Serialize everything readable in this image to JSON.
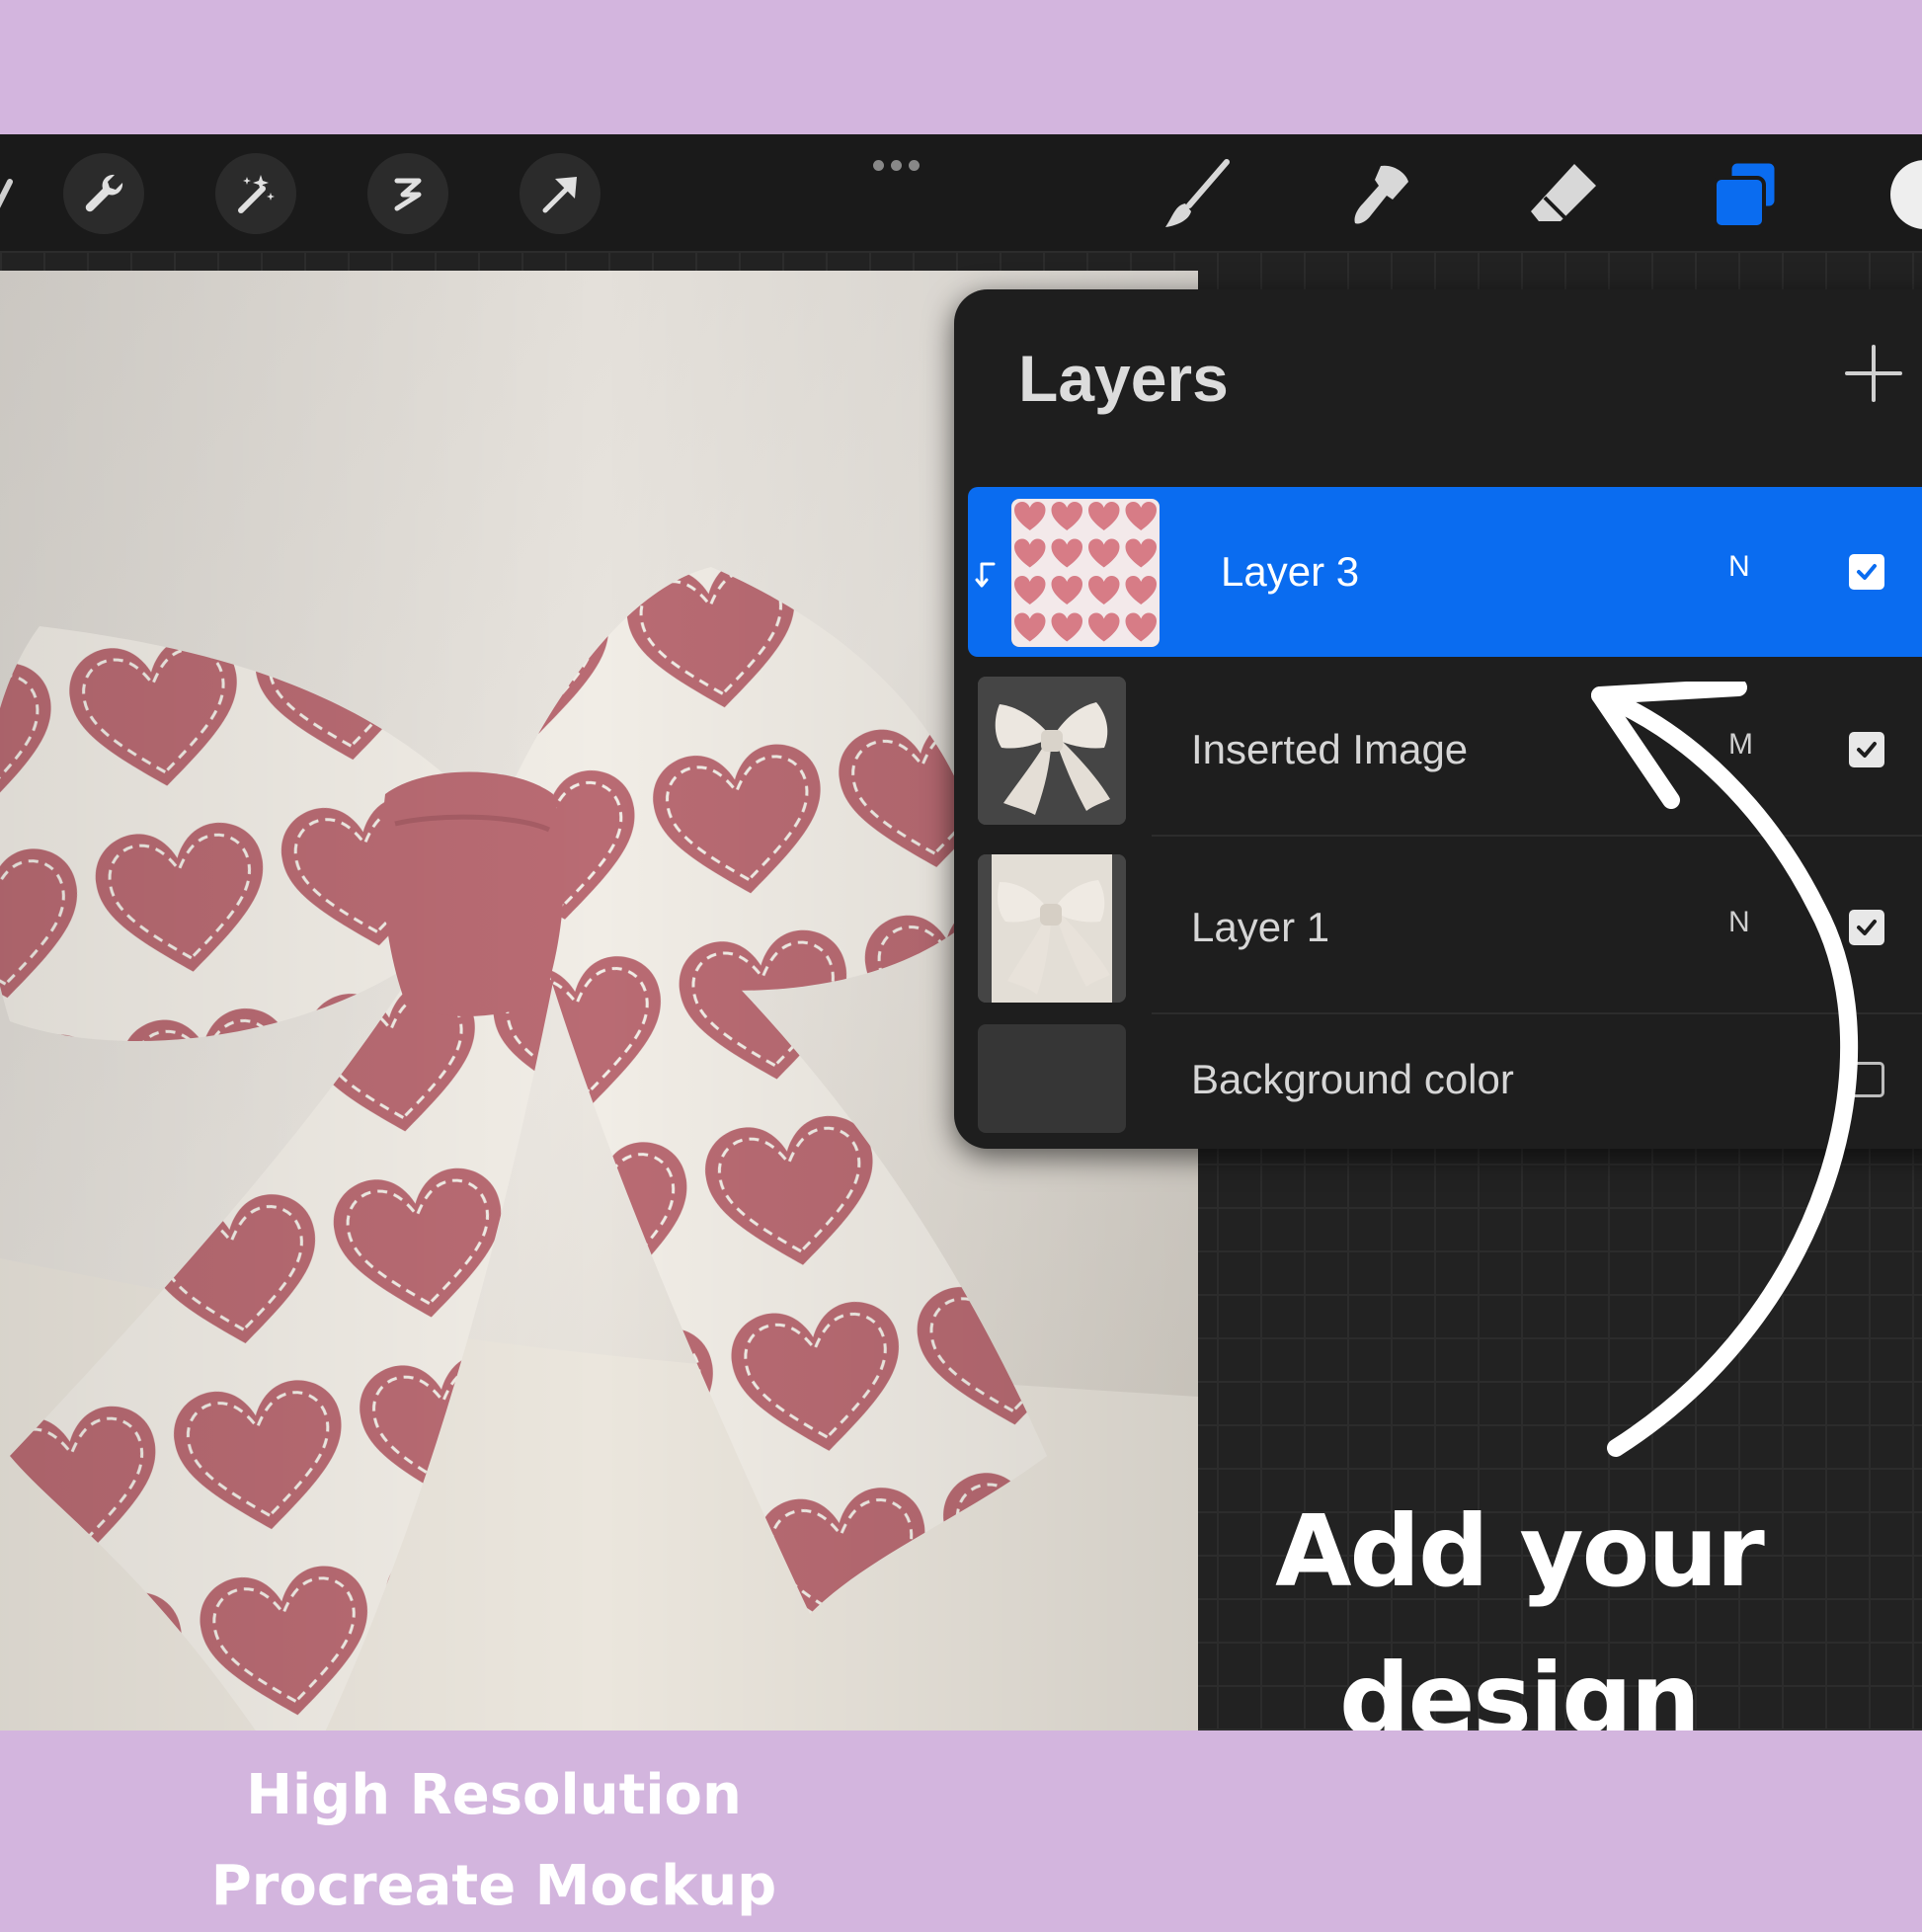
{
  "app": {
    "name": "Procreate",
    "accent_color": "#0a6cf0",
    "frame_color": "#D3B5DE"
  },
  "toolbar": {
    "left_tools": [
      {
        "icon": "gallery-icon"
      },
      {
        "icon": "wrench-icon"
      },
      {
        "icon": "magic-wand-icon"
      },
      {
        "icon": "selection-icon"
      },
      {
        "icon": "move-arrow-icon"
      }
    ],
    "more_icon": "more-dots-icon",
    "right_tools": [
      {
        "icon": "brush-icon"
      },
      {
        "icon": "smudge-icon"
      },
      {
        "icon": "eraser-icon"
      },
      {
        "icon": "layers-icon",
        "active": true
      },
      {
        "icon": "color-swatch-icon"
      }
    ]
  },
  "layers_panel": {
    "title": "Layers",
    "add_icon": "plus-icon",
    "layers": [
      {
        "name": "Layer 3",
        "blend": "N",
        "visible": true,
        "selected": true,
        "clipping": true
      },
      {
        "name": "Inserted Image",
        "blend": "M",
        "visible": true,
        "selected": false,
        "clipping": false
      },
      {
        "name": "Layer 1",
        "blend": "N",
        "visible": true,
        "selected": false,
        "clipping": false
      },
      {
        "name": "Background color",
        "blend": "",
        "visible": false,
        "selected": false,
        "clipping": false
      }
    ]
  },
  "callout": {
    "line1": "Add your",
    "line2": "design here!"
  },
  "caption": {
    "line1": "High Resolution",
    "line2": "Procreate Mockup"
  }
}
